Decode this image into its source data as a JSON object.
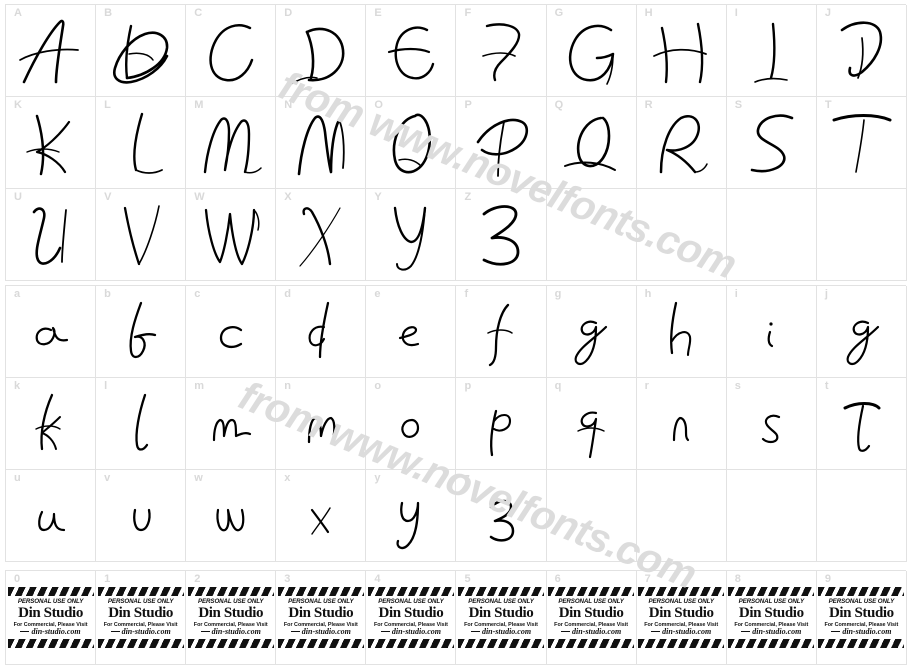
{
  "page": {
    "type": "font-specimen-character-map",
    "background_color": "#ffffff",
    "grid_line_color": "#e2e2e2",
    "label_color": "#d9d9d9",
    "glyph_ink_color": "#000000",
    "watermark_color": "#dcdcdc"
  },
  "watermarks": {
    "top": "from www.novelfonts.com",
    "bottom": "from www.novelfonts.com"
  },
  "uppercase": {
    "rows": [
      [
        {
          "label": "A",
          "glyph": "A"
        },
        {
          "label": "B",
          "glyph": "B"
        },
        {
          "label": "C",
          "glyph": "C"
        },
        {
          "label": "D",
          "glyph": "D"
        },
        {
          "label": "E",
          "glyph": "E"
        },
        {
          "label": "F",
          "glyph": "F"
        },
        {
          "label": "G",
          "glyph": "G"
        },
        {
          "label": "H",
          "glyph": "H"
        },
        {
          "label": "I",
          "glyph": "I"
        },
        {
          "label": "J",
          "glyph": "J"
        }
      ],
      [
        {
          "label": "K",
          "glyph": "K"
        },
        {
          "label": "L",
          "glyph": "L"
        },
        {
          "label": "M",
          "glyph": "M"
        },
        {
          "label": "N",
          "glyph": "N"
        },
        {
          "label": "O",
          "glyph": "O"
        },
        {
          "label": "P",
          "glyph": "P"
        },
        {
          "label": "Q",
          "glyph": "Q"
        },
        {
          "label": "R",
          "glyph": "R"
        },
        {
          "label": "S",
          "glyph": "S"
        },
        {
          "label": "T",
          "glyph": "T"
        }
      ],
      [
        {
          "label": "U",
          "glyph": "U"
        },
        {
          "label": "V",
          "glyph": "V"
        },
        {
          "label": "W",
          "glyph": "W"
        },
        {
          "label": "X",
          "glyph": "X"
        },
        {
          "label": "Y",
          "glyph": "Y"
        },
        {
          "label": "Z",
          "glyph": "Z"
        },
        {
          "label": "",
          "glyph": ""
        },
        {
          "label": "",
          "glyph": ""
        },
        {
          "label": "",
          "glyph": ""
        },
        {
          "label": "",
          "glyph": ""
        }
      ]
    ]
  },
  "lowercase": {
    "rows": [
      [
        {
          "label": "a",
          "glyph": "a"
        },
        {
          "label": "b",
          "glyph": "b"
        },
        {
          "label": "c",
          "glyph": "c"
        },
        {
          "label": "d",
          "glyph": "d"
        },
        {
          "label": "e",
          "glyph": "e"
        },
        {
          "label": "f",
          "glyph": "f"
        },
        {
          "label": "g",
          "glyph": "g"
        },
        {
          "label": "h",
          "glyph": "h"
        },
        {
          "label": "i",
          "glyph": "i"
        },
        {
          "label": "j",
          "glyph": "j"
        }
      ],
      [
        {
          "label": "k",
          "glyph": "k"
        },
        {
          "label": "l",
          "glyph": "l"
        },
        {
          "label": "m",
          "glyph": "m"
        },
        {
          "label": "n",
          "glyph": "n"
        },
        {
          "label": "o",
          "glyph": "o"
        },
        {
          "label": "p",
          "glyph": "p"
        },
        {
          "label": "q",
          "glyph": "q"
        },
        {
          "label": "r",
          "glyph": "r"
        },
        {
          "label": "s",
          "glyph": "s"
        },
        {
          "label": "t",
          "glyph": "t"
        }
      ],
      [
        {
          "label": "u",
          "glyph": "u"
        },
        {
          "label": "v",
          "glyph": "v"
        },
        {
          "label": "w",
          "glyph": "w"
        },
        {
          "label": "x",
          "glyph": "x"
        },
        {
          "label": "y",
          "glyph": "y"
        },
        {
          "label": "z",
          "glyph": "z"
        },
        {
          "label": "",
          "glyph": ""
        },
        {
          "label": "",
          "glyph": ""
        },
        {
          "label": "",
          "glyph": ""
        },
        {
          "label": "",
          "glyph": ""
        }
      ]
    ]
  },
  "digits": {
    "labels": [
      "0",
      "1",
      "2",
      "3",
      "4",
      "5",
      "6",
      "7",
      "8",
      "9"
    ],
    "badge": {
      "personal_use": "PERSONAL USE ONLY",
      "studio_name": "Din Studio",
      "commercial_note": "For Commercial, Please Visit",
      "url": "din-studio.com"
    }
  }
}
